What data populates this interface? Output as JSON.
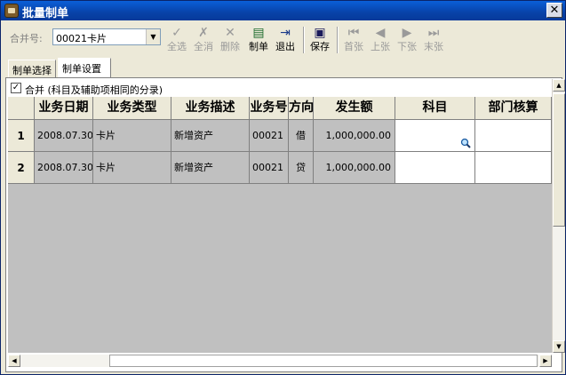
{
  "window": {
    "title": "批量制单",
    "close_glyph": "✕"
  },
  "toolbar": {
    "merge_label": "合并号:",
    "merge_value": "00021卡片",
    "buttons": [
      {
        "label": "全选",
        "icon": "select-all-icon",
        "glyph": "✓",
        "enabled": false
      },
      {
        "label": "全消",
        "icon": "deselect-all-icon",
        "glyph": "✗",
        "enabled": false
      },
      {
        "label": "删除",
        "icon": "delete-icon",
        "glyph": "✕",
        "enabled": false
      },
      {
        "label": "制单",
        "icon": "make-voucher-icon",
        "glyph": "▤",
        "enabled": true
      },
      {
        "label": "退出",
        "icon": "exit-icon",
        "glyph": "⇥",
        "enabled": true
      },
      {
        "label": "保存",
        "icon": "save-icon",
        "glyph": "▣",
        "enabled": true
      },
      {
        "label": "首张",
        "icon": "first-icon",
        "glyph": "⏮",
        "enabled": false
      },
      {
        "label": "上张",
        "icon": "prev-icon",
        "glyph": "◀",
        "enabled": false
      },
      {
        "label": "下张",
        "icon": "next-icon",
        "glyph": "▶",
        "enabled": false
      },
      {
        "label": "末张",
        "icon": "last-icon",
        "glyph": "⏭",
        "enabled": false
      }
    ]
  },
  "tabs": [
    {
      "label": "制单选择",
      "active": false
    },
    {
      "label": "制单设置",
      "active": true
    }
  ],
  "merge_option": {
    "checked": true,
    "check_glyph": "✓",
    "label": "合并 (科目及辅助项相同的分录)"
  },
  "grid": {
    "columns": [
      "业务日期",
      "业务类型",
      "业务描述",
      "业务号",
      "方向",
      "发生额",
      "科目",
      "部门核算"
    ],
    "rows": [
      {
        "num": "1",
        "date": "2008.07.30",
        "type": "卡片",
        "desc": "新增资产",
        "no": "00021",
        "dir": "借",
        "amount": "1,000,000.00",
        "subject": "",
        "dept": ""
      },
      {
        "num": "2",
        "date": "2008.07.30",
        "type": "卡片",
        "desc": "新增资产",
        "no": "00021",
        "dir": "贷",
        "amount": "1,000,000.00",
        "subject": "",
        "dept": ""
      }
    ]
  },
  "colors": {
    "title_bar": "#0842a8",
    "grid_bg": "#c0c0c0",
    "editable_cell": "#ffffff"
  }
}
